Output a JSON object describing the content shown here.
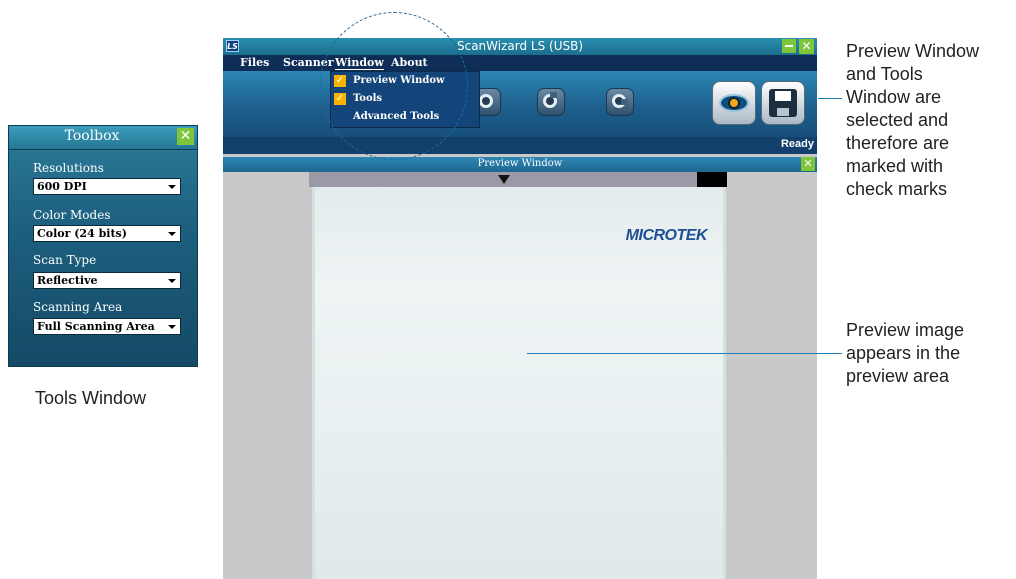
{
  "toolbox": {
    "title": "Toolbox",
    "close_icon": "close-x-icon",
    "fields": [
      {
        "label": "Resolutions",
        "value": "600 DPI"
      },
      {
        "label": "Color Modes",
        "value": "Color (24 bits)"
      },
      {
        "label": "Scan Type",
        "value": "Reflective"
      },
      {
        "label": "Scanning Area",
        "value": "Full Scanning Area"
      }
    ]
  },
  "captions": {
    "tools_window": "Tools Window",
    "callout_menu": [
      "Preview Window",
      "and Tools",
      "Window are",
      "selected and",
      "therefore are",
      "marked with",
      "check marks"
    ],
    "callout_preview": [
      "Preview image",
      "appears in the",
      "preview area"
    ]
  },
  "window": {
    "title": "ScanWizard LS (USB)",
    "app_icon_text": "LS",
    "menu": [
      "Files",
      "Scanner",
      "Window",
      "About"
    ],
    "active_menu": "Window",
    "window_menu": [
      {
        "label": "Preview Window",
        "checked": true
      },
      {
        "label": "Tools",
        "checked": true
      },
      {
        "label": "Advanced Tools",
        "checked": false
      }
    ],
    "toolbar_icons": [
      "zoom-icon",
      "rotate-icon",
      "reset-icon",
      "preview-eye-icon",
      "save-disk-icon"
    ],
    "status": "Ready",
    "preview_title": "Preview Window",
    "brand_on_scan": "MICROTEK"
  },
  "colors": {
    "accent_green": "#7ec53b",
    "titlebar_blue": "#2a8fb0",
    "menubar_navy": "#0e2d57",
    "check_orange": "#f7b400",
    "callout_line": "#1a7fb3"
  }
}
